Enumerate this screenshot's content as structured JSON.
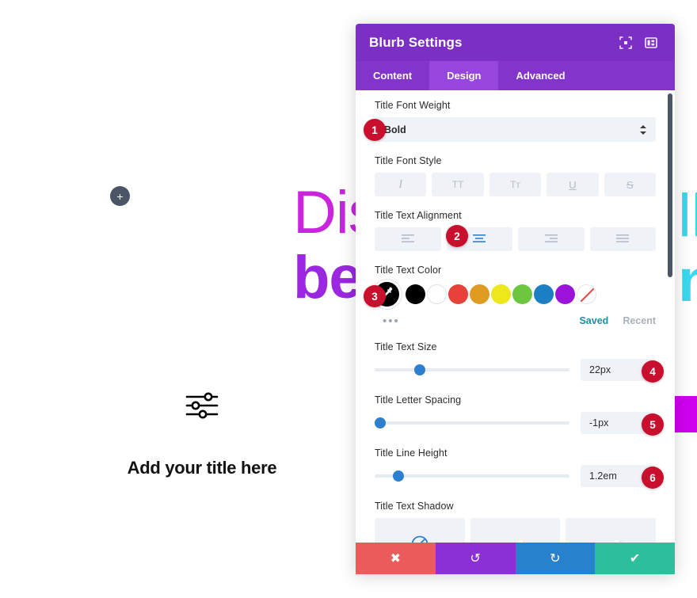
{
  "canvas": {
    "add_button_label": "+",
    "hero_line1": "Dis",
    "hero_line2": "be",
    "hero_right_line1": "ll",
    "hero_right_line2": "nt",
    "blurb_icon": "sliders-icon",
    "blurb_title": "Add your title here"
  },
  "panel": {
    "title": "Blurb Settings",
    "header_icons": [
      {
        "name": "focus-target-icon"
      },
      {
        "name": "layout-panel-icon"
      }
    ],
    "tabs": [
      {
        "label": "Content",
        "active": false
      },
      {
        "label": "Design",
        "active": true
      },
      {
        "label": "Advanced",
        "active": false
      }
    ],
    "fields": {
      "font_weight": {
        "label": "Title Font Weight",
        "value": "Bold",
        "badge": "1"
      },
      "font_style": {
        "label": "Title Font Style",
        "options": [
          {
            "glyph": "I",
            "name": "italic",
            "active": false
          },
          {
            "glyph": "TT",
            "name": "uppercase",
            "active": false
          },
          {
            "glyph": "Tᴛ",
            "name": "small-caps",
            "active": false
          },
          {
            "glyph": "U",
            "name": "underline",
            "active": false
          },
          {
            "glyph": "S",
            "name": "strikethrough",
            "active": false
          }
        ]
      },
      "text_alignment": {
        "label": "Title Text Alignment",
        "badge": "2",
        "options": [
          {
            "name": "align-left",
            "active": false
          },
          {
            "name": "align-center",
            "active": true
          },
          {
            "name": "align-right",
            "active": false
          },
          {
            "name": "align-justify",
            "active": false
          }
        ]
      },
      "text_color": {
        "label": "Title Text Color",
        "badge": "3",
        "picker_color": "#000000",
        "swatches": [
          {
            "name": "black",
            "hex": "#000000"
          },
          {
            "name": "white",
            "hex": "#ffffff"
          },
          {
            "name": "red",
            "hex": "#e8413a"
          },
          {
            "name": "orange",
            "hex": "#e09c22"
          },
          {
            "name": "yellow",
            "hex": "#ede81c"
          },
          {
            "name": "green",
            "hex": "#6cc63f"
          },
          {
            "name": "blue",
            "hex": "#1c7fc4"
          },
          {
            "name": "purple",
            "hex": "#9b13d8"
          },
          {
            "name": "none",
            "hex": "none"
          }
        ],
        "more_dots": "•••",
        "saved_label": "Saved",
        "recent_label": "Recent"
      },
      "text_size": {
        "label": "Title Text Size",
        "value": "22px",
        "badge": "4",
        "thumb_percent": 23
      },
      "letter_spacing": {
        "label": "Title Letter Spacing",
        "value": "-1px",
        "badge": "5",
        "thumb_percent": 3
      },
      "line_height": {
        "label": "Title Line Height",
        "value": "1.2em",
        "badge": "6",
        "thumb_percent": 12
      },
      "text_shadow": {
        "label": "Title Text Shadow",
        "options": [
          {
            "name": "shadow-none",
            "glyph": "",
            "active": true
          },
          {
            "name": "shadow-preset-1",
            "glyph": "aA",
            "active": false
          },
          {
            "name": "shadow-preset-2",
            "glyph": "aA",
            "active": false
          }
        ]
      }
    },
    "footer": [
      {
        "name": "cancel-button",
        "glyph": "✖"
      },
      {
        "name": "undo-button",
        "glyph": "↺"
      },
      {
        "name": "redo-button",
        "glyph": "↻"
      },
      {
        "name": "save-button",
        "glyph": "✔"
      }
    ]
  },
  "colors": {
    "header_purple": "#7b2fc4",
    "tab_purple": "#8234cb",
    "tab_active": "#9646dd",
    "badge_red": "#c8102e",
    "accent_blue": "#2d7fd0"
  }
}
